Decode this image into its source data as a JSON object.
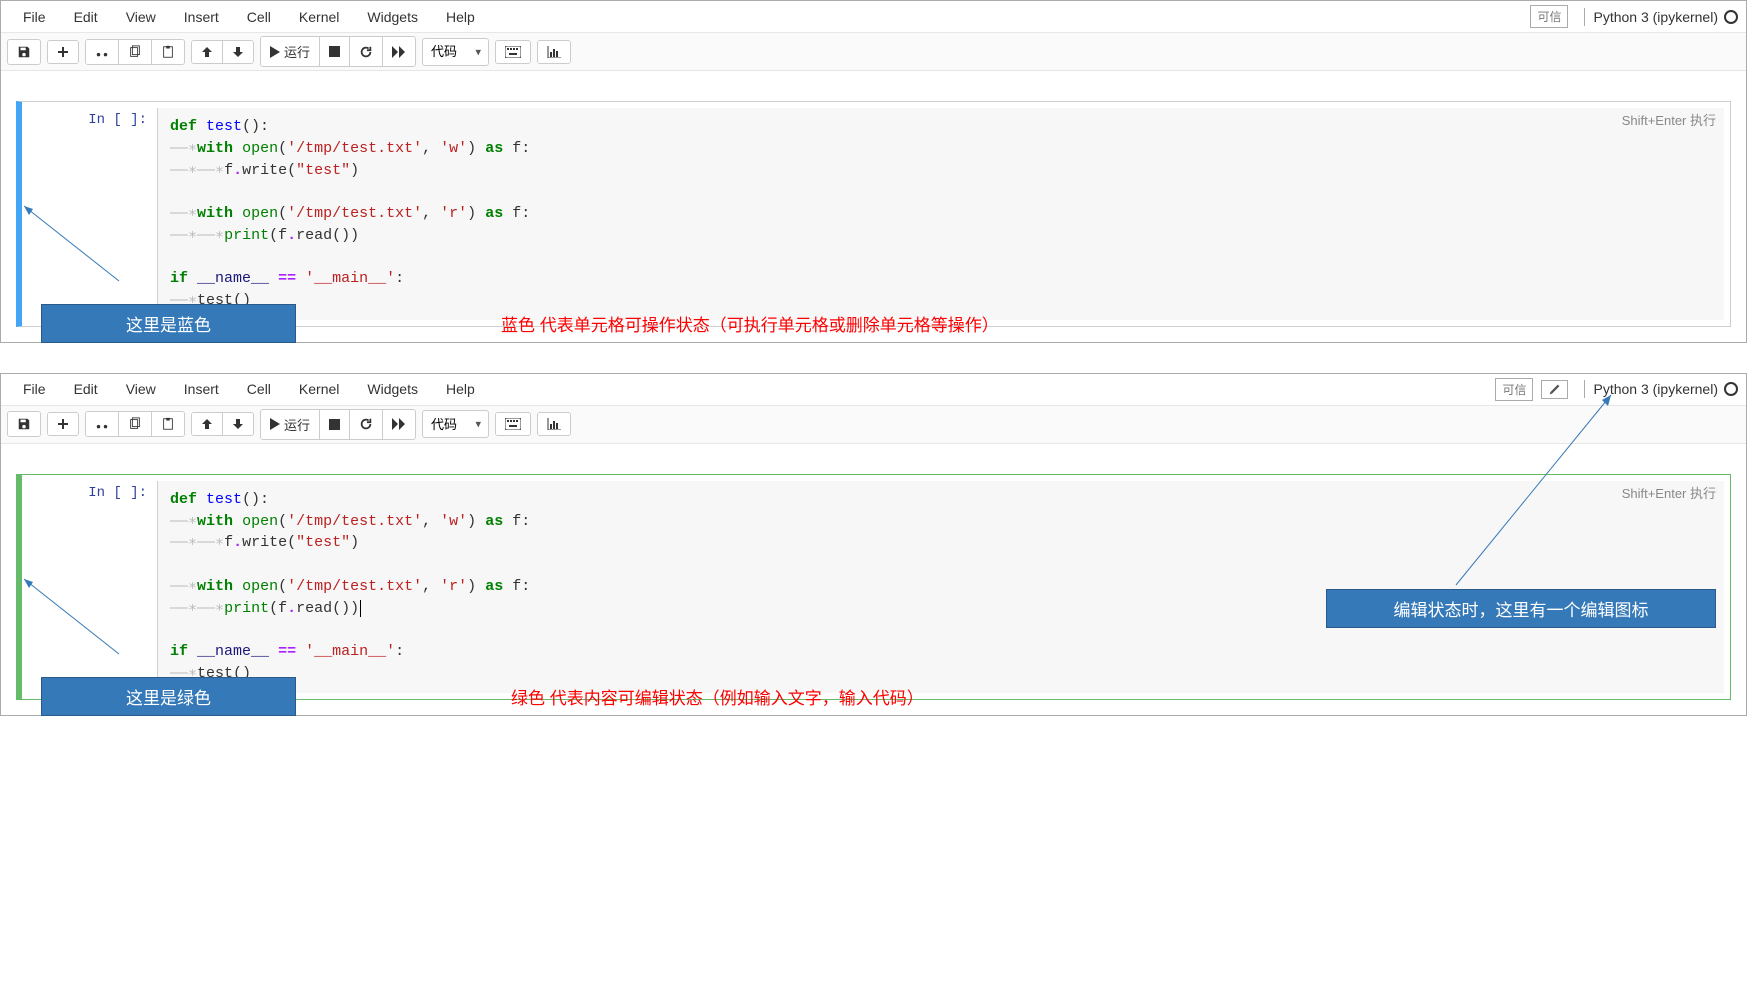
{
  "menus": {
    "file": "File",
    "edit": "Edit",
    "view": "View",
    "insert": "Insert",
    "cell": "Cell",
    "kernel": "Kernel",
    "widgets": "Widgets",
    "help": "Help"
  },
  "header": {
    "trusted": "可信",
    "kernel": "Python 3 (ipykernel)"
  },
  "toolbar": {
    "run_label": "运行",
    "cell_type": "代码"
  },
  "cell": {
    "prompt": "In  [  ]:",
    "shift_enter": "Shift+Enter 执行",
    "code_tokens": [
      {
        "line": [
          {
            "t": "kw",
            "v": "def"
          },
          {
            "t": "p",
            "v": " "
          },
          {
            "t": "fn",
            "v": "test"
          },
          {
            "t": "p",
            "v": "():"
          }
        ]
      },
      {
        "indent": 1,
        "line": [
          {
            "t": "kw",
            "v": "with"
          },
          {
            "t": "p",
            "v": " "
          },
          {
            "t": "builtin",
            "v": "open"
          },
          {
            "t": "p",
            "v": "("
          },
          {
            "t": "str",
            "v": "'/tmp/test.txt'"
          },
          {
            "t": "p",
            "v": ", "
          },
          {
            "t": "str",
            "v": "'w'"
          },
          {
            "t": "p",
            "v": ") "
          },
          {
            "t": "kw",
            "v": "as"
          },
          {
            "t": "p",
            "v": " f:"
          }
        ]
      },
      {
        "indent": 2,
        "line": [
          {
            "t": "p",
            "v": "f"
          },
          {
            "t": "op",
            "v": "."
          },
          {
            "t": "p",
            "v": "write("
          },
          {
            "t": "str",
            "v": "\"test\""
          },
          {
            "t": "p",
            "v": ")"
          }
        ]
      },
      {
        "blank": true
      },
      {
        "indent": 1,
        "line": [
          {
            "t": "kw",
            "v": "with"
          },
          {
            "t": "p",
            "v": " "
          },
          {
            "t": "builtin",
            "v": "open"
          },
          {
            "t": "p",
            "v": "("
          },
          {
            "t": "str",
            "v": "'/tmp/test.txt'"
          },
          {
            "t": "p",
            "v": ", "
          },
          {
            "t": "str",
            "v": "'r'"
          },
          {
            "t": "p",
            "v": ") "
          },
          {
            "t": "kw",
            "v": "as"
          },
          {
            "t": "p",
            "v": " f:"
          }
        ]
      },
      {
        "indent": 2,
        "line": [
          {
            "t": "builtin",
            "v": "print"
          },
          {
            "t": "p",
            "v": "(f"
          },
          {
            "t": "op",
            "v": "."
          },
          {
            "t": "p",
            "v": "read())"
          }
        ]
      },
      {
        "blank": true
      },
      {
        "line": [
          {
            "t": "kw",
            "v": "if"
          },
          {
            "t": "p",
            "v": " "
          },
          {
            "t": "var",
            "v": "__name__"
          },
          {
            "t": "p",
            "v": " "
          },
          {
            "t": "op",
            "v": "=="
          },
          {
            "t": "p",
            "v": " "
          },
          {
            "t": "str",
            "v": "'__main__'"
          },
          {
            "t": "p",
            "v": ":"
          }
        ]
      },
      {
        "indent": 1,
        "line": [
          {
            "t": "p",
            "v": "test()"
          }
        ]
      }
    ]
  },
  "annotations": {
    "blue_label": "这里是蓝色",
    "blue_desc": "蓝色 代表单元格可操作状态（可执行单元格或删除单元格等操作）",
    "green_label": "这里是绿色",
    "green_desc": "绿色 代表内容可编辑状态（例如输入文字，输入代码）",
    "edit_icon_note": "编辑状态时，这里有一个编辑图标"
  }
}
